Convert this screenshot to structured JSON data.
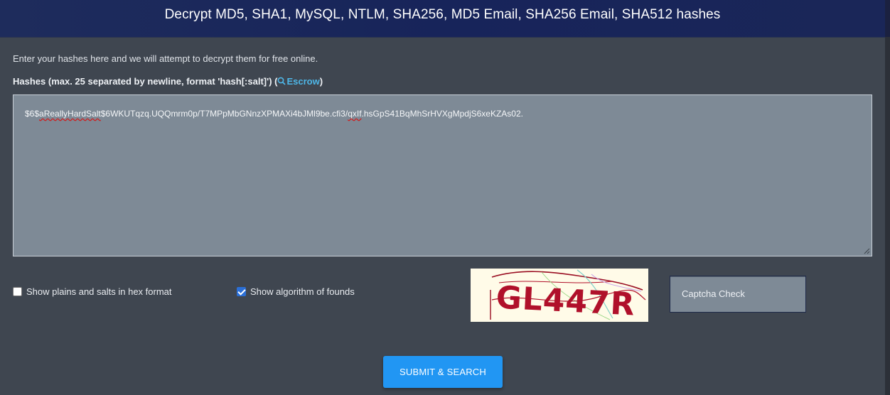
{
  "header": {
    "title": "Decrypt MD5, SHA1, MySQL, NTLM, SHA256, MD5 Email, SHA256 Email, SHA512 hashes"
  },
  "intro_text": "Enter your hashes here and we will attempt to decrypt them for free online.",
  "hashes_label": {
    "prefix": "Hashes (max. 25 separated by newline, format 'hash[:salt]') (",
    "link": "Escrow",
    "suffix": ")"
  },
  "hashes_input": {
    "part1": "$6$",
    "part2": "aReallyHardSalt",
    "part3": "$6WKUTqzq.UQQmrm0p/T7MPpMbGNnzXPMAXi4bJMl9be.cfi3/",
    "part4": "qxIf",
    "part5": ".hsGpS41BqMhSrHVXgMpdjS6xeKZAs02."
  },
  "options": {
    "hex_format": {
      "label": "Show plains and salts in hex format",
      "checked": false
    },
    "show_algorithm": {
      "label": "Show algorithm of founds",
      "checked": true
    }
  },
  "captcha": {
    "image_text": "GL447R",
    "input_placeholder": "Captcha Check"
  },
  "submit_button": "SUBMIT & SEARCH",
  "colors": {
    "accent": "#2196f3",
    "link": "#4eb7e8",
    "header": "#1a2658",
    "background": "#3f4650",
    "captcha_text": "#b0102a"
  }
}
